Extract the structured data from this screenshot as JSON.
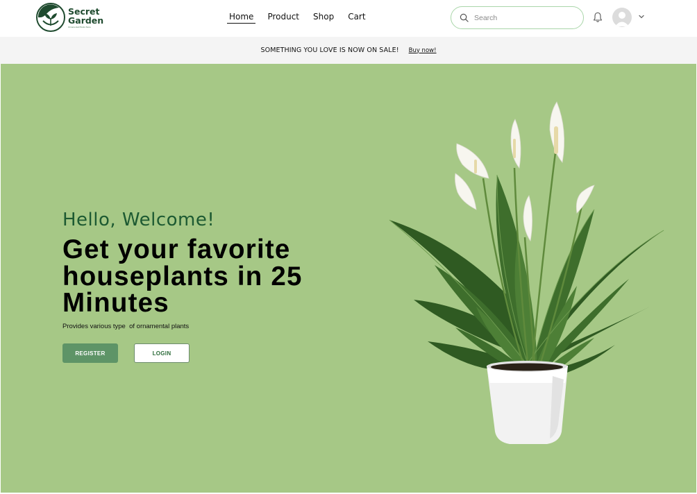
{
  "brand": {
    "name_line1": "Secret",
    "name_line2": "Garden",
    "tagline": "Ornamental Plants Store",
    "color": "#1f4b2f"
  },
  "nav": {
    "items": [
      {
        "label": "Home",
        "active": true
      },
      {
        "label": "Product",
        "active": false
      },
      {
        "label": "Shop",
        "active": false
      },
      {
        "label": "Cart",
        "active": false
      }
    ]
  },
  "search": {
    "placeholder": "Search",
    "value": "",
    "icon": "search-icon"
  },
  "header_icons": {
    "notifications": "bell-icon",
    "account": "avatar",
    "menu": "chevron-down-icon"
  },
  "promo": {
    "text": "SOMETHING YOU LOVE IS NOW ON SALE!",
    "link": "Buy now!"
  },
  "hero": {
    "greeting": "Hello, Welcome!",
    "headline": "Get your favorite houseplants in 25 Minutes",
    "subtext": "Provides various type  of ornamental plants",
    "register_label": "REGISTER",
    "login_label": "LOGIN",
    "image": "peace-lily-plant"
  },
  "colors": {
    "hero_bg": "#a6c886",
    "accent": "#5e9467",
    "greeting": "#1d5a32",
    "search_border": "#a9d6a9"
  }
}
